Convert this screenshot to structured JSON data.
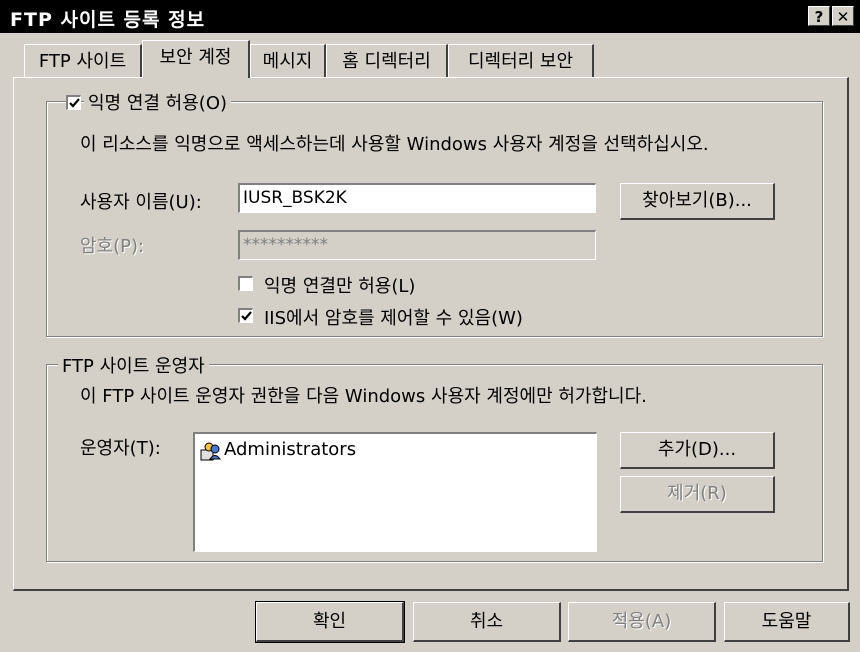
{
  "window": {
    "title": "FTP 사이트 등록 정보",
    "help_btn": "?",
    "close_btn": "✕"
  },
  "tabs": [
    {
      "label": "FTP 사이트"
    },
    {
      "label": "보안 계정"
    },
    {
      "label": "메시지"
    },
    {
      "label": "홈 디렉터리"
    },
    {
      "label": "디렉터리 보안"
    }
  ],
  "anonymous": {
    "checkbox_label": "익명 연결 허용(O)",
    "checked": true,
    "description": "이 리소스를 익명으로 액세스하는데 사용할 Windows 사용자 계정을 선택하십시오.",
    "username_label": "사용자 이름(U):",
    "username_value": "IUSR_BSK2K",
    "browse_button": "찾아보기(B)...",
    "password_label": "암호(P):",
    "password_value": "**********",
    "only_anon_label": "익명 연결만 허용(L)",
    "only_anon_checked": false,
    "iis_pw_label": "IIS에서 암호를 제어할 수 있음(W)",
    "iis_pw_checked": true
  },
  "operators": {
    "group_title": "FTP 사이트 운영자",
    "description": "이 FTP 사이트 운영자 권한을 다음 Windows 사용자 계정에만 허가합니다.",
    "list_label": "운영자(T):",
    "items": [
      {
        "name": "Administrators",
        "icon": "user-group-icon"
      }
    ],
    "add_button": "추가(D)...",
    "remove_button": "제거(R)"
  },
  "footer": {
    "ok": "확인",
    "cancel": "취소",
    "apply": "적용(A)",
    "help": "도움말"
  }
}
